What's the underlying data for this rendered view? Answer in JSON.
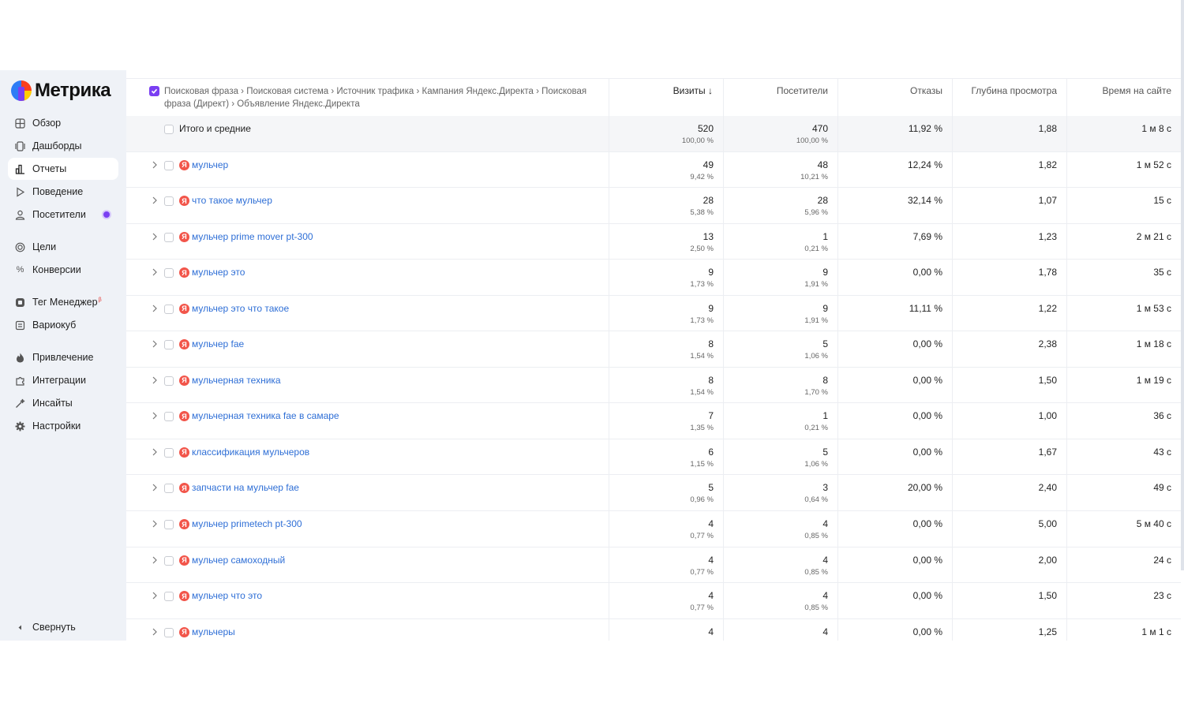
{
  "logo": {
    "name": "Метрика"
  },
  "nav": {
    "overview": "Обзор",
    "dashboards": "Дашборды",
    "reports": "Отчеты",
    "behavior": "Поведение",
    "visitors": "Посетители",
    "goals": "Цели",
    "conversions": "Конверсии",
    "tag_manager": "Тег Менеджер",
    "tag_manager_badge": "β",
    "variocube": "Вариокуб",
    "acquisition": "Привлечение",
    "integrations": "Интеграции",
    "insights": "Инсайты",
    "settings": "Настройки",
    "collapse": "Свернуть"
  },
  "table": {
    "dimensions_header": "Поисковая фраза › Поисковая система › Источник трафика › Кампания Яндекс.Директа › Поисковая фраза (Директ) › Объявление Яндекс.Директа",
    "columns": {
      "visits": "Визиты",
      "sort_icon": "↓",
      "visitors": "Посетители",
      "bounces": "Отказы",
      "depth": "Глубина просмотра",
      "time": "Время на сайте"
    },
    "total": {
      "label": "Итого и средние",
      "visits": "520",
      "visits_pct": "100,00 %",
      "visitors": "470",
      "visitors_pct": "100,00 %",
      "bounces": "11,92 %",
      "depth": "1,88",
      "time": "1 м 8 с"
    },
    "rows": [
      {
        "phrase": "мульчер",
        "visits": "49",
        "visits_pct": "9,42 %",
        "visitors": "48",
        "visitors_pct": "10,21 %",
        "bounces": "12,24 %",
        "depth": "1,82",
        "time": "1 м 52 с"
      },
      {
        "phrase": "что такое мульчер",
        "visits": "28",
        "visits_pct": "5,38 %",
        "visitors": "28",
        "visitors_pct": "5,96 %",
        "bounces": "32,14 %",
        "depth": "1,07",
        "time": "15 с"
      },
      {
        "phrase": "мульчер prime mover pt-300",
        "visits": "13",
        "visits_pct": "2,50 %",
        "visitors": "1",
        "visitors_pct": "0,21 %",
        "bounces": "7,69 %",
        "depth": "1,23",
        "time": "2 м 21 с"
      },
      {
        "phrase": "мульчер это",
        "visits": "9",
        "visits_pct": "1,73 %",
        "visitors": "9",
        "visitors_pct": "1,91 %",
        "bounces": "0,00 %",
        "depth": "1,78",
        "time": "35 с"
      },
      {
        "phrase": "мульчер это что такое",
        "visits": "9",
        "visits_pct": "1,73 %",
        "visitors": "9",
        "visitors_pct": "1,91 %",
        "bounces": "11,11 %",
        "depth": "1,22",
        "time": "1 м 53 с"
      },
      {
        "phrase": "мульчер fae",
        "visits": "8",
        "visits_pct": "1,54 %",
        "visitors": "5",
        "visitors_pct": "1,06 %",
        "bounces": "0,00 %",
        "depth": "2,38",
        "time": "1 м 18 с"
      },
      {
        "phrase": "мульчерная техника",
        "visits": "8",
        "visits_pct": "1,54 %",
        "visitors": "8",
        "visitors_pct": "1,70 %",
        "bounces": "0,00 %",
        "depth": "1,50",
        "time": "1 м 19 с"
      },
      {
        "phrase": "мульчерная техника fae в самаре",
        "visits": "7",
        "visits_pct": "1,35 %",
        "visitors": "1",
        "visitors_pct": "0,21 %",
        "bounces": "0,00 %",
        "depth": "1,00",
        "time": "36 с"
      },
      {
        "phrase": "классификация мульчеров",
        "visits": "6",
        "visits_pct": "1,15 %",
        "visitors": "5",
        "visitors_pct": "1,06 %",
        "bounces": "0,00 %",
        "depth": "1,67",
        "time": "43 с"
      },
      {
        "phrase": "запчасти на мульчер fae",
        "visits": "5",
        "visits_pct": "0,96 %",
        "visitors": "3",
        "visitors_pct": "0,64 %",
        "bounces": "20,00 %",
        "depth": "2,40",
        "time": "49 с"
      },
      {
        "phrase": "мульчер primetech pt-300",
        "visits": "4",
        "visits_pct": "0,77 %",
        "visitors": "4",
        "visitors_pct": "0,85 %",
        "bounces": "0,00 %",
        "depth": "5,00",
        "time": "5 м 40 с"
      },
      {
        "phrase": "мульчер самоходный",
        "visits": "4",
        "visits_pct": "0,77 %",
        "visitors": "4",
        "visitors_pct": "0,85 %",
        "bounces": "0,00 %",
        "depth": "2,00",
        "time": "24 с"
      },
      {
        "phrase": "мульчер что это",
        "visits": "4",
        "visits_pct": "0,77 %",
        "visitors": "4",
        "visitors_pct": "0,85 %",
        "bounces": "0,00 %",
        "depth": "1,50",
        "time": "23 с"
      },
      {
        "phrase": "мульчеры",
        "visits": "4",
        "visits_pct": "",
        "visitors": "4",
        "visitors_pct": "",
        "bounces": "0,00 %",
        "depth": "1,25",
        "time": "1 м 1 с"
      }
    ]
  },
  "colors": {
    "accent": "#7a3ff2",
    "link": "#2f6fd6",
    "yandex": "#f2554a",
    "sidebar_bg": "#eff2f7"
  }
}
